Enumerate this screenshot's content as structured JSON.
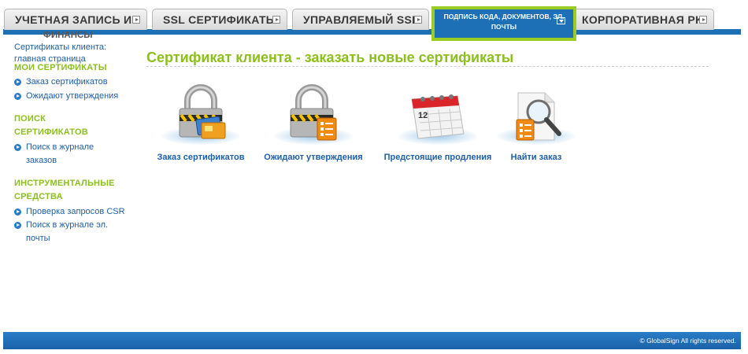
{
  "tabs": [
    {
      "label": "УЧЕТНАЯ ЗАПИСЬ И"
    },
    {
      "label": "SSL СЕРТИФИКАТЫ"
    },
    {
      "label": "УПРАВЛЯЕМЫЙ SSL"
    },
    {
      "label": "КОРПОРАТИВНАЯ PKI"
    }
  ],
  "active_tab": {
    "line1": "ПОДПИСЬ КОДА, ДОКУМЕНТОВ, ЭЛ.",
    "line2": "ПОЧТЫ"
  },
  "sidebar": {
    "cut_text": "ФИНАНСЫ",
    "home_line1": "Сертификаты клиента:",
    "home_line2": "главная страница",
    "sections": [
      {
        "heading_lines": [
          "МОИ СЕРТИФИКАТЫ"
        ],
        "links": [
          {
            "lines": [
              "Заказ сертификатов"
            ]
          },
          {
            "lines": [
              "Ожидают утверждения"
            ]
          }
        ]
      },
      {
        "heading_lines": [
          "ПОИСК",
          "СЕРТИФИКАТОВ"
        ],
        "links": [
          {
            "lines": [
              "Поиск в журнале",
              "заказов"
            ]
          }
        ]
      },
      {
        "heading_lines": [
          "ИНСТРУМЕНТАЛЬНЫЕ",
          "СРЕДСТВА"
        ],
        "links": [
          {
            "lines": [
              "Проверка запросов CSR"
            ]
          },
          {
            "lines": [
              "Поиск в журнале эл.",
              "почты"
            ]
          }
        ]
      }
    ]
  },
  "main": {
    "title": "Сертификат клиента - заказать новые сертификаты",
    "actions": [
      {
        "label": "Заказ сертификатов",
        "icon": "padlock-with-cards-icon"
      },
      {
        "label": "Ожидают утверждения",
        "icon": "padlock-with-checklist-icon"
      },
      {
        "label": "Предстоящие продления",
        "icon": "calendar-icon",
        "calendar_day": "12"
      },
      {
        "label": "Найти заказ",
        "icon": "magnifier-document-icon"
      }
    ]
  },
  "footer": {
    "copyright": "© GlobalSign All rights reserved."
  },
  "colors": {
    "brand_blue": "#1d6fb6",
    "accent_green": "#8cbe1e",
    "highlight_border": "#9acd24",
    "link_blue": "#1d5fa8"
  }
}
